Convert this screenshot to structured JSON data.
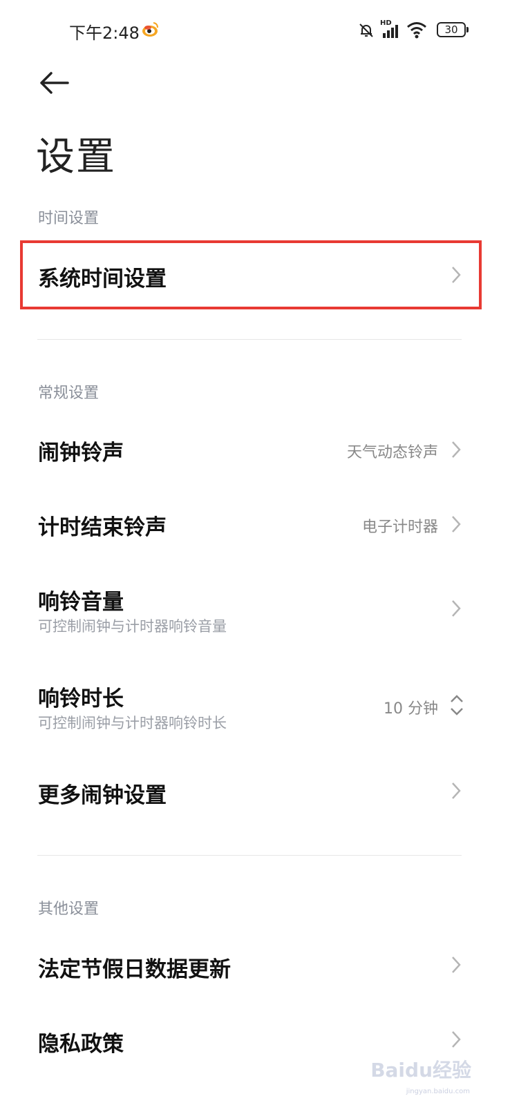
{
  "status_bar": {
    "time": "下午2:48",
    "battery": "30",
    "network_label": "HD"
  },
  "header": {
    "title": "设置"
  },
  "sections": [
    {
      "header": "时间设置",
      "items": [
        {
          "label": "系统时间设置"
        }
      ]
    },
    {
      "header": "常规设置",
      "items": [
        {
          "label": "闹钟铃声",
          "value": "天气动态铃声"
        },
        {
          "label": "计时结束铃声",
          "value": "电子计时器"
        },
        {
          "label": "响铃音量",
          "sub": "可控制闹钟与计时器响铃音量"
        },
        {
          "label": "响铃时长",
          "sub": "可控制闹钟与计时器响铃时长",
          "value": "10 分钟"
        },
        {
          "label": "更多闹钟设置"
        }
      ]
    },
    {
      "header": "其他设置",
      "items": [
        {
          "label": "法定节假日数据更新"
        },
        {
          "label": "隐私政策"
        }
      ]
    }
  ],
  "highlight_color": "#e83a33",
  "watermark": {
    "text": "Baidu经验",
    "sub": "jingyan.baidu.com"
  }
}
